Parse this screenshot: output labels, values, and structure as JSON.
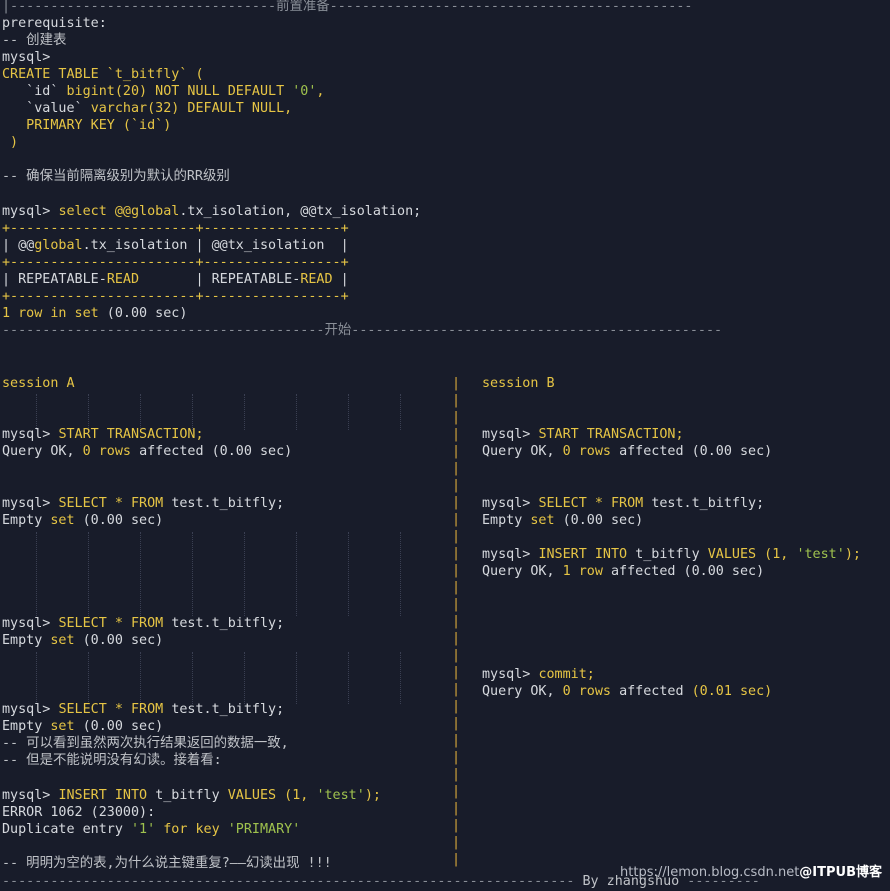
{
  "header": {
    "top_rule_left": "|---------------------------------",
    "top_title": "前置准备",
    "top_rule_right": "---------------------------------------------"
  },
  "prep": {
    "prerequisite": "prerequisite:",
    "comment_create": "-- 创建表",
    "mysql_prompt": "mysql>",
    "create_1": "CREATE TABLE `t_bitfly` (",
    "create_2_a": "   `id` ",
    "create_2_b": "bigint(20) NOT NULL DEFAULT ",
    "create_2_c": "'0'",
    "create_2_d": ",",
    "create_3_a": "   `value` ",
    "create_3_b": "varchar(32) DEFAULT NULL,",
    "create_4": "   PRIMARY KEY (`id`)",
    "create_5": " )",
    "comment_rr": "-- 确保当前隔离级别为默认的RR级别",
    "select_prompt": "mysql> ",
    "select_a": "select @@",
    "select_b": "global",
    "select_c": ".tx_isolation, @@tx_isolation;",
    "table_border": "+-----------------------+-----------------+",
    "table_head_a": "| @@",
    "table_head_b": "global",
    "table_head_c": ".tx_isolation | @@tx_isolation  |",
    "row_a": "| REPEATABLE-",
    "row_b": "READ",
    "row_c": "       | REPEATABLE-",
    "row_d": "READ",
    "row_e": " |",
    "rows_a": "1 ",
    "rows_b": "row in set",
    "rows_c": " (0.00 sec)"
  },
  "start_rule": {
    "left": "----------------------------------------",
    "title": "开始",
    "right": "----------------------------------------------"
  },
  "session_a": {
    "title": "session A",
    "start_tx_prompt": "mysql> ",
    "start_tx_cmd": "START TRANSACTION;",
    "ok_0": "Query OK, ",
    "ok_1": "0 ",
    "ok_2": "rows ",
    "ok_3": "affected (0.00 sec)",
    "sel1_prompt": "mysql> ",
    "sel1_cmd": "SELECT * FROM ",
    "sel1_tbl": "test.t_bitfly;",
    "empty1_a": "Empty ",
    "empty1_b": "set",
    "empty1_c": " (0.00 sec)",
    "sel2_prompt": "mysql> ",
    "sel2_cmd": "SELECT * FROM ",
    "sel2_tbl": "test.t_bitfly;",
    "empty2_a": "Empty ",
    "empty2_b": "set",
    "empty2_c": " (0.00 sec)",
    "sel3_prompt": "mysql> ",
    "sel3_cmd": "SELECT * FROM ",
    "sel3_tbl": "test.t_bitfly;",
    "empty3_a": "Empty ",
    "empty3_b": "set",
    "empty3_c": " (0.00 sec)",
    "note_1": "-- 可以看到虽然两次执行结果返回的数据一致,",
    "note_2": "-- 但是不能说明没有幻读。接着看:",
    "ins_prompt": "mysql> ",
    "ins_cmd": "INSERT INTO ",
    "ins_tbl": "t_bitfly ",
    "ins_vals": "VALUES (1, ",
    "ins_str": "'test'",
    "ins_end": ");",
    "err_1": "ERROR 1062 (23000):",
    "err_2_a": "Duplicate entry ",
    "err_2_b": "'1'",
    "err_2_c": " for key ",
    "err_2_d": "'PRIMARY'",
    "final_note": "-- 明明为空的表,为什么说主键重复?——幻读出现 !!!"
  },
  "session_b": {
    "title": "session B",
    "start_tx_prompt": "mysql> ",
    "start_tx_cmd": "START TRANSACTION;",
    "ok_0": "Query OK, ",
    "ok_1": "0 ",
    "ok_2": "rows ",
    "ok_3": "affected (0.00 sec)",
    "sel_prompt": "mysql> ",
    "sel_cmd": "SELECT * FROM ",
    "sel_tbl": "test.t_bitfly;",
    "empty_a": "Empty ",
    "empty_b": "set",
    "empty_c": " (0.00 sec)",
    "ins_prompt": "mysql> ",
    "ins_cmd": "INSERT INTO ",
    "ins_tbl": "t_bitfly ",
    "ins_vals": "VALUES (1, ",
    "ins_str": "'test'",
    "ins_end": ");",
    "ins_ok_a": "Query OK, ",
    "ins_ok_b": "1 ",
    "ins_ok_c": "row ",
    "ins_ok_d": "affected (0.00 sec)",
    "commit_prompt": "mysql> ",
    "commit_cmd": "commit;",
    "commit_ok_a": "Query OK, ",
    "commit_ok_b": "0 ",
    "commit_ok_c": "rows ",
    "commit_ok_d": "affected ",
    "commit_ok_e": "(0.01 sec)"
  },
  "footer": {
    "rule_left": "-----------------------------------------------------------------------",
    "author": " By zhangshuo ",
    "rule_right": "---------",
    "watermark_url": "https://lemon.blog.csdn.net",
    "watermark_brand": "@ITPUB博客"
  },
  "colors": {
    "background": "#181c2a",
    "keyword": "#e6c545",
    "string": "#9fc24e",
    "text": "#d6d9de"
  }
}
